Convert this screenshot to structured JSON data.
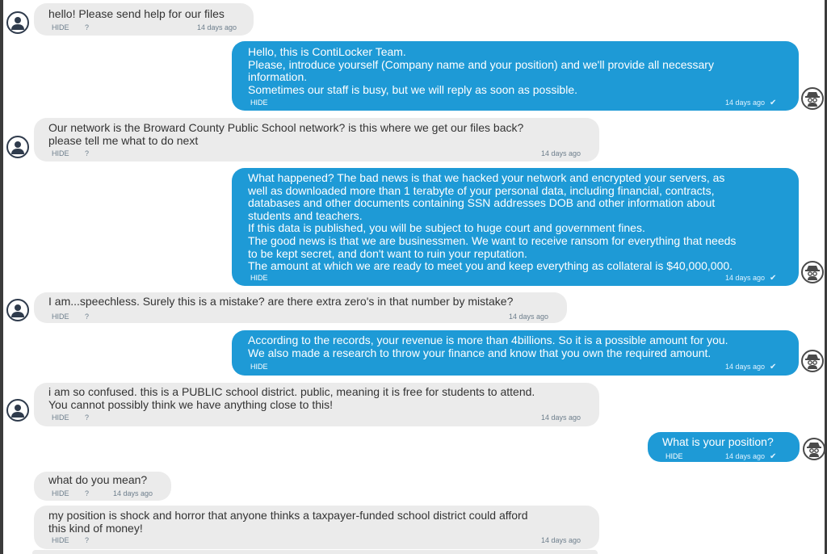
{
  "messages": [
    {
      "side": "in",
      "lines": [
        "hello! Please send help for our files"
      ],
      "hide": "HIDE",
      "q": "?",
      "time": "14 days ago"
    },
    {
      "side": "out",
      "lines": [
        "Hello, this is ContiLocker Team.",
        "Please, introduce yourself (Company name and your position) and we'll provide all necessary",
        "information.",
        "Sometimes our staff is busy, but we will reply as soon as possible."
      ],
      "hide": "HIDE",
      "time": "14 days ago"
    },
    {
      "side": "in",
      "lines": [
        "Our network is the Broward County Public School network? is this where we get our files back?",
        "please tell me what to do next"
      ],
      "hide": "HIDE",
      "q": "?",
      "time": "14 days ago"
    },
    {
      "side": "out",
      "lines": [
        "What happened? The bad news is that we hacked your network and encrypted your servers, as",
        "well as downloaded more than 1 terabyte of your personal data, including financial, contracts,",
        "databases and other documents containing SSN addresses DOB and other information about",
        "students and teachers.",
        "If this data is published, you will be subject to huge court and government fines.",
        "The good news is that we are businessmen. We want to receive ransom for everything that needs",
        "to be kept secret, and don't want to ruin your reputation.",
        "The amount at which we are ready to meet you and keep everything as collateral is $40,000,000."
      ],
      "hide": "HIDE",
      "time": "14 days ago"
    },
    {
      "side": "in",
      "lines": [
        "I am...speechless. Surely this is a mistake? are there extra zero's in that number by mistake?"
      ],
      "hide": "HIDE",
      "q": "?",
      "time": "14 days ago"
    },
    {
      "side": "out",
      "lines": [
        "According to the records, your revenue is more than 4billions. So it is a possible amount for you.",
        "We also made a research to throw your finance and know that you own the required amount."
      ],
      "hide": "HIDE",
      "time": "14 days ago"
    },
    {
      "side": "in",
      "lines": [
        "i am so confused. this is a PUBLIC school district. public, meaning it is free for students to attend.",
        "You cannot possibly think we have anything close to this!"
      ],
      "hide": "HIDE",
      "q": "?",
      "time": "14 days ago"
    },
    {
      "side": "out",
      "lines": [
        "What is your position?"
      ],
      "hide": "HIDE",
      "time": "14 days ago"
    },
    {
      "side": "in",
      "lines": [
        "what do you mean?"
      ],
      "hide": "HIDE",
      "q": "?",
      "time": "14 days ago"
    },
    {
      "side": "in",
      "lines": [
        "my position is shock and horror that anyone thinks a taxpayer-funded school district could afford",
        "this kind of money!"
      ],
      "hide": "HIDE",
      "q": "?",
      "time": "14 days ago"
    }
  ],
  "icons": {
    "user": "user-avatar-icon",
    "support": "hacker-avatar-icon",
    "read": "check-icon"
  },
  "colors": {
    "incoming_bg": "#ebebeb",
    "outgoing_bg": "#1e9ad6",
    "hide_link": "#3a93d3"
  }
}
